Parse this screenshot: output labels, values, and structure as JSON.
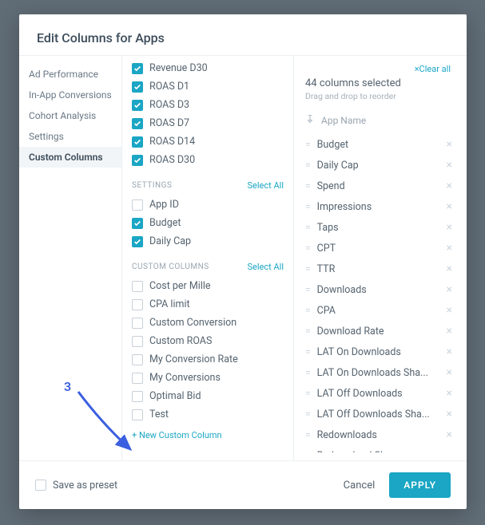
{
  "modal": {
    "title": "Edit Columns for Apps",
    "nav": [
      {
        "label": "Ad Performance",
        "active": false
      },
      {
        "label": "In-App Conversions",
        "active": false
      },
      {
        "label": "Cohort Analysis",
        "active": false
      },
      {
        "label": "Settings",
        "active": false
      },
      {
        "label": "Custom Columns",
        "active": true
      }
    ],
    "groups_visible": [
      {
        "title": "",
        "select_all": false,
        "items": [
          {
            "label": "Revenue D30",
            "checked": true
          },
          {
            "label": "ROAS D1",
            "checked": true
          },
          {
            "label": "ROAS D3",
            "checked": true
          },
          {
            "label": "ROAS D7",
            "checked": true
          },
          {
            "label": "ROAS D14",
            "checked": true
          },
          {
            "label": "ROAS D30",
            "checked": true
          }
        ]
      },
      {
        "title": "SETTINGS",
        "select_all_label": "Select All",
        "items": [
          {
            "label": "App ID",
            "checked": false
          },
          {
            "label": "Budget",
            "checked": true
          },
          {
            "label": "Daily Cap",
            "checked": true
          }
        ]
      },
      {
        "title": "CUSTOM COLUMNS",
        "select_all_label": "Select All",
        "items": [
          {
            "label": "Cost per Mille",
            "checked": false
          },
          {
            "label": "CPA limit",
            "checked": false
          },
          {
            "label": "Custom Conversion",
            "checked": false
          },
          {
            "label": "Custom ROAS",
            "checked": false
          },
          {
            "label": "My Conversion Rate",
            "checked": false
          },
          {
            "label": "My Conversions",
            "checked": false
          },
          {
            "label": "Optimal Bid",
            "checked": false
          },
          {
            "label": "Test",
            "checked": false
          }
        ]
      }
    ],
    "new_custom_label": "+ New Custom Column",
    "right": {
      "clear_all_label": "×Clear all",
      "selected_count_text": "44 columns selected",
      "drag_hint": "Drag and drop to reorder",
      "pinned": "App Name",
      "order": [
        "Budget",
        "Daily Cap",
        "Spend",
        "Impressions",
        "Taps",
        "CPT",
        "TTR",
        "Downloads",
        "CPA",
        "Download Rate",
        "LAT On Downloads",
        "LAT On Downloads Sha...",
        "LAT Off  Downloads",
        "LAT Off Downloads Sha...",
        "Redownloads",
        "Redownload Share"
      ]
    },
    "footer": {
      "save_preset_label": "Save as preset",
      "cancel_label": "Cancel",
      "apply_label": "APPLY"
    }
  },
  "annotation": {
    "number": "3"
  }
}
